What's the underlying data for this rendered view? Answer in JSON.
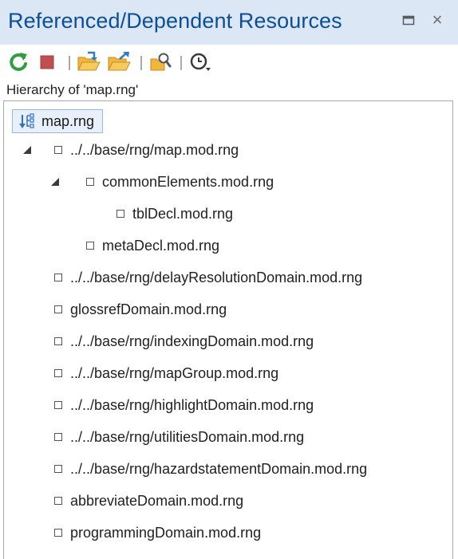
{
  "window": {
    "title": "Referenced/Dependent Resources",
    "restore_icon": "restore-icon",
    "close_glyph": "×"
  },
  "toolbar": {
    "icons": [
      "refresh-icon",
      "stop-icon",
      "open-folder-icon",
      "open-folder-arrow-icon",
      "find-references-icon",
      "history-dropdown-icon"
    ]
  },
  "hierarchy": {
    "label": "Hierarchy of 'map.rng'",
    "root": "map.rng",
    "items": [
      {
        "label": "../../base/rng/map.mod.rng",
        "expanded": true
      },
      {
        "label": "commonElements.mod.rng",
        "expanded": true
      },
      {
        "label": "tblDecl.mod.rng"
      },
      {
        "label": "metaDecl.mod.rng"
      },
      {
        "label": "../../base/rng/delayResolutionDomain.mod.rng"
      },
      {
        "label": "glossrefDomain.mod.rng"
      },
      {
        "label": "../../base/rng/indexingDomain.mod.rng"
      },
      {
        "label": "../../base/rng/mapGroup.mod.rng"
      },
      {
        "label": "../../base/rng/highlightDomain.mod.rng"
      },
      {
        "label": "../../base/rng/utilitiesDomain.mod.rng"
      },
      {
        "label": "../../base/rng/hazardstatementDomain.mod.rng"
      },
      {
        "label": "abbreviateDomain.mod.rng"
      },
      {
        "label": "programmingDomain.mod.rng"
      }
    ]
  },
  "colors": {
    "title_bg": "#dbe7f5",
    "title_text": "#0b4f9c",
    "refresh_green": "#2e9e3e",
    "stop_red": "#c0504d",
    "folder_yellow": "#f2b739",
    "arrow_blue": "#2f7bd1",
    "selection_bg": "#e8f0fb"
  }
}
